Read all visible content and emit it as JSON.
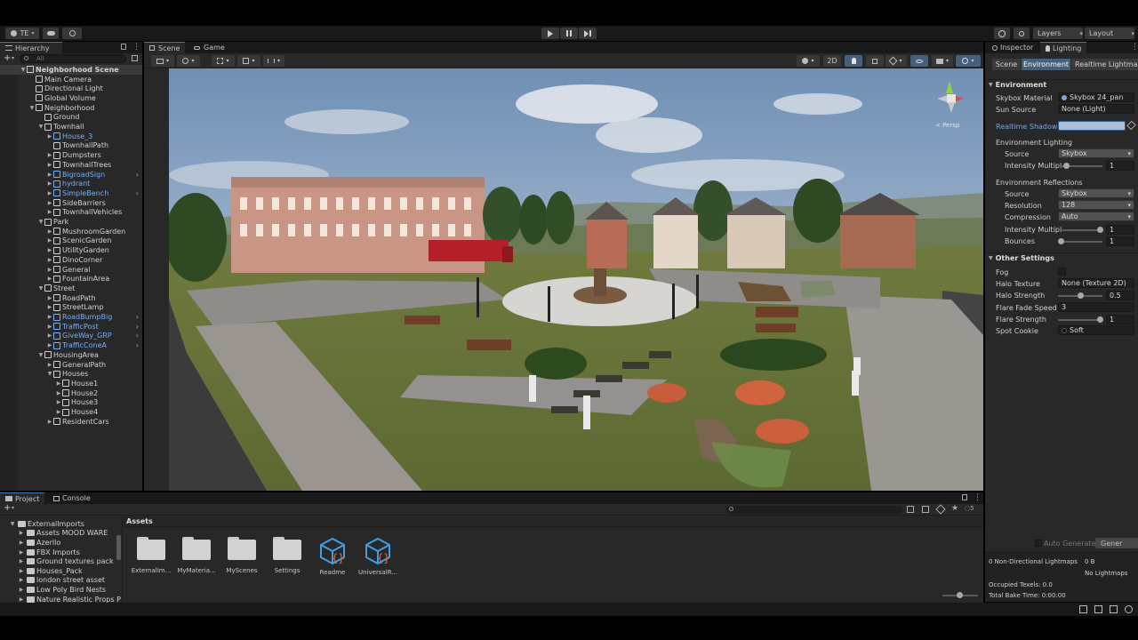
{
  "toolbar": {
    "account": "TE",
    "layers": "Layers",
    "layout": "Layout"
  },
  "hierarchy": {
    "tab": "Hierarchy",
    "search_placeholder": "All",
    "items": [
      {
        "label": "Neighborhood Scene",
        "depth": 0,
        "expand": "open",
        "kind": "scene"
      },
      {
        "label": "Main Camera",
        "depth": 1,
        "expand": "",
        "kind": "go"
      },
      {
        "label": "Directional Light",
        "depth": 1,
        "expand": "",
        "kind": "go"
      },
      {
        "label": "Global Volume",
        "depth": 1,
        "expand": "",
        "kind": "go"
      },
      {
        "label": "Neighborhood",
        "depth": 1,
        "expand": "open",
        "kind": "go"
      },
      {
        "label": "Ground",
        "depth": 2,
        "expand": "",
        "kind": "go"
      },
      {
        "label": "Townhall",
        "depth": 2,
        "expand": "open",
        "kind": "go"
      },
      {
        "label": "House_3",
        "depth": 3,
        "expand": "closed",
        "kind": "prefab"
      },
      {
        "label": "TownhallPath",
        "depth": 3,
        "expand": "",
        "kind": "go"
      },
      {
        "label": "Dumpsters",
        "depth": 3,
        "expand": "closed",
        "kind": "go"
      },
      {
        "label": "TownhallTrees",
        "depth": 3,
        "expand": "closed",
        "kind": "go"
      },
      {
        "label": "BigroadSign",
        "depth": 3,
        "expand": "closed",
        "kind": "prefab"
      },
      {
        "label": "hydrant",
        "depth": 3,
        "expand": "closed",
        "kind": "prefab"
      },
      {
        "label": "SimpleBench",
        "depth": 3,
        "expand": "closed",
        "kind": "prefab"
      },
      {
        "label": "SideBarriers",
        "depth": 3,
        "expand": "closed",
        "kind": "go"
      },
      {
        "label": "TownhallVehicles",
        "depth": 3,
        "expand": "closed",
        "kind": "go"
      },
      {
        "label": "Park",
        "depth": 2,
        "expand": "open",
        "kind": "go"
      },
      {
        "label": "MushroomGarden",
        "depth": 3,
        "expand": "closed",
        "kind": "go"
      },
      {
        "label": "ScenicGarden",
        "depth": 3,
        "expand": "closed",
        "kind": "go"
      },
      {
        "label": "UtilityGarden",
        "depth": 3,
        "expand": "closed",
        "kind": "go"
      },
      {
        "label": "DinoCorner",
        "depth": 3,
        "expand": "closed",
        "kind": "go"
      },
      {
        "label": "General",
        "depth": 3,
        "expand": "closed",
        "kind": "go"
      },
      {
        "label": "FountainArea",
        "depth": 3,
        "expand": "closed",
        "kind": "go"
      },
      {
        "label": "Street",
        "depth": 2,
        "expand": "open",
        "kind": "go"
      },
      {
        "label": "RoadPath",
        "depth": 3,
        "expand": "closed",
        "kind": "go"
      },
      {
        "label": "StreetLamp",
        "depth": 3,
        "expand": "closed",
        "kind": "go"
      },
      {
        "label": "RoadBumpBig",
        "depth": 3,
        "expand": "closed",
        "kind": "prefab"
      },
      {
        "label": "TrafficPost",
        "depth": 3,
        "expand": "closed",
        "kind": "prefab"
      },
      {
        "label": "GiveWay_GRP",
        "depth": 3,
        "expand": "closed",
        "kind": "prefab"
      },
      {
        "label": "TrafficConeA",
        "depth": 3,
        "expand": "closed",
        "kind": "prefab"
      },
      {
        "label": "HousingArea",
        "depth": 2,
        "expand": "open",
        "kind": "go"
      },
      {
        "label": "GeneralPath",
        "depth": 3,
        "expand": "closed",
        "kind": "go"
      },
      {
        "label": "Houses",
        "depth": 3,
        "expand": "open",
        "kind": "go"
      },
      {
        "label": "House1",
        "depth": 4,
        "expand": "closed",
        "kind": "go"
      },
      {
        "label": "House2",
        "depth": 4,
        "expand": "closed",
        "kind": "go"
      },
      {
        "label": "House3",
        "depth": 4,
        "expand": "closed",
        "kind": "go"
      },
      {
        "label": "House4",
        "depth": 4,
        "expand": "closed",
        "kind": "go"
      },
      {
        "label": "ResidentCars",
        "depth": 3,
        "expand": "closed",
        "kind": "go"
      }
    ]
  },
  "scene": {
    "tab_scene": "Scene",
    "tab_game": "Game",
    "btn_2d": "2D",
    "persp": "< Persp"
  },
  "inspector": {
    "tab_inspector": "Inspector",
    "tab_lighting": "Lighting",
    "subtabs": [
      "Scene",
      "Environment",
      "Realtime Lightmaps"
    ],
    "environment_header": "Environment",
    "skybox_material_label": "Skybox Material",
    "skybox_material_value": "Skybox 24_pan",
    "sun_source_label": "Sun Source",
    "sun_source_value": "None (Light)",
    "realtime_shadow_label": "Realtime Shadow C",
    "env_lighting_header": "Environment Lighting",
    "env_lighting_source_label": "Source",
    "env_lighting_source_value": "Skybox",
    "env_lighting_intensity_label": "Intensity Multipl",
    "env_lighting_intensity_value": "1",
    "env_reflections_header": "Environment Reflections",
    "refl_source_label": "Source",
    "refl_source_value": "Skybox",
    "refl_resolution_label": "Resolution",
    "refl_resolution_value": "128",
    "refl_compression_label": "Compression",
    "refl_compression_value": "Auto",
    "refl_intensity_label": "Intensity Multipl",
    "refl_intensity_value": "1",
    "refl_bounces_label": "Bounces",
    "refl_bounces_value": "1",
    "other_header": "Other Settings",
    "fog_label": "Fog",
    "halo_texture_label": "Halo Texture",
    "halo_texture_value": "None (Texture 2D)",
    "halo_strength_label": "Halo Strength",
    "halo_strength_value": "0.5",
    "flare_fade_label": "Flare Fade Speed",
    "flare_fade_value": "3",
    "flare_strength_label": "Flare Strength",
    "flare_strength_value": "1",
    "spot_cookie_label": "Spot Cookie",
    "spot_cookie_value": "Soft",
    "auto_generate": "Auto Generate",
    "generate": "Gener",
    "stat_lightmaps": "0 Non-Directional Lightmaps",
    "stat_size": "0 B",
    "stat_none": "No Lightmaps",
    "stat_texels": "Occupied Texels: 0.0",
    "stat_bake": "Total Bake Time: 0:00:00"
  },
  "project": {
    "tab_project": "Project",
    "tab_console": "Console",
    "tree": [
      {
        "label": "ExternalImports",
        "depth": 0
      },
      {
        "label": "Assets MOOD WARE",
        "depth": 1
      },
      {
        "label": "Azerllo",
        "depth": 1
      },
      {
        "label": "FBX Imports",
        "depth": 1
      },
      {
        "label": "Ground textures pack",
        "depth": 1
      },
      {
        "label": "Houses_Pack",
        "depth": 1
      },
      {
        "label": "london street asset",
        "depth": 1
      },
      {
        "label": "Low Poly Bird Nests",
        "depth": 1
      },
      {
        "label": "Nature Realistic Props P",
        "depth": 1
      }
    ],
    "breadcrumb": "Assets",
    "badge_count": "5",
    "assets": [
      {
        "label": "ExternalIm...",
        "kind": "folder"
      },
      {
        "label": "MyMateria...",
        "kind": "folder"
      },
      {
        "label": "MyScenes",
        "kind": "folder"
      },
      {
        "label": "Settings",
        "kind": "folder"
      },
      {
        "label": "Readme",
        "kind": "script"
      },
      {
        "label": "UniversalR...",
        "kind": "script"
      }
    ]
  },
  "colors": {
    "accent": "#3a79bb",
    "prefab": "#6fb0ff",
    "panel": "#282828",
    "dark": "#191919"
  }
}
